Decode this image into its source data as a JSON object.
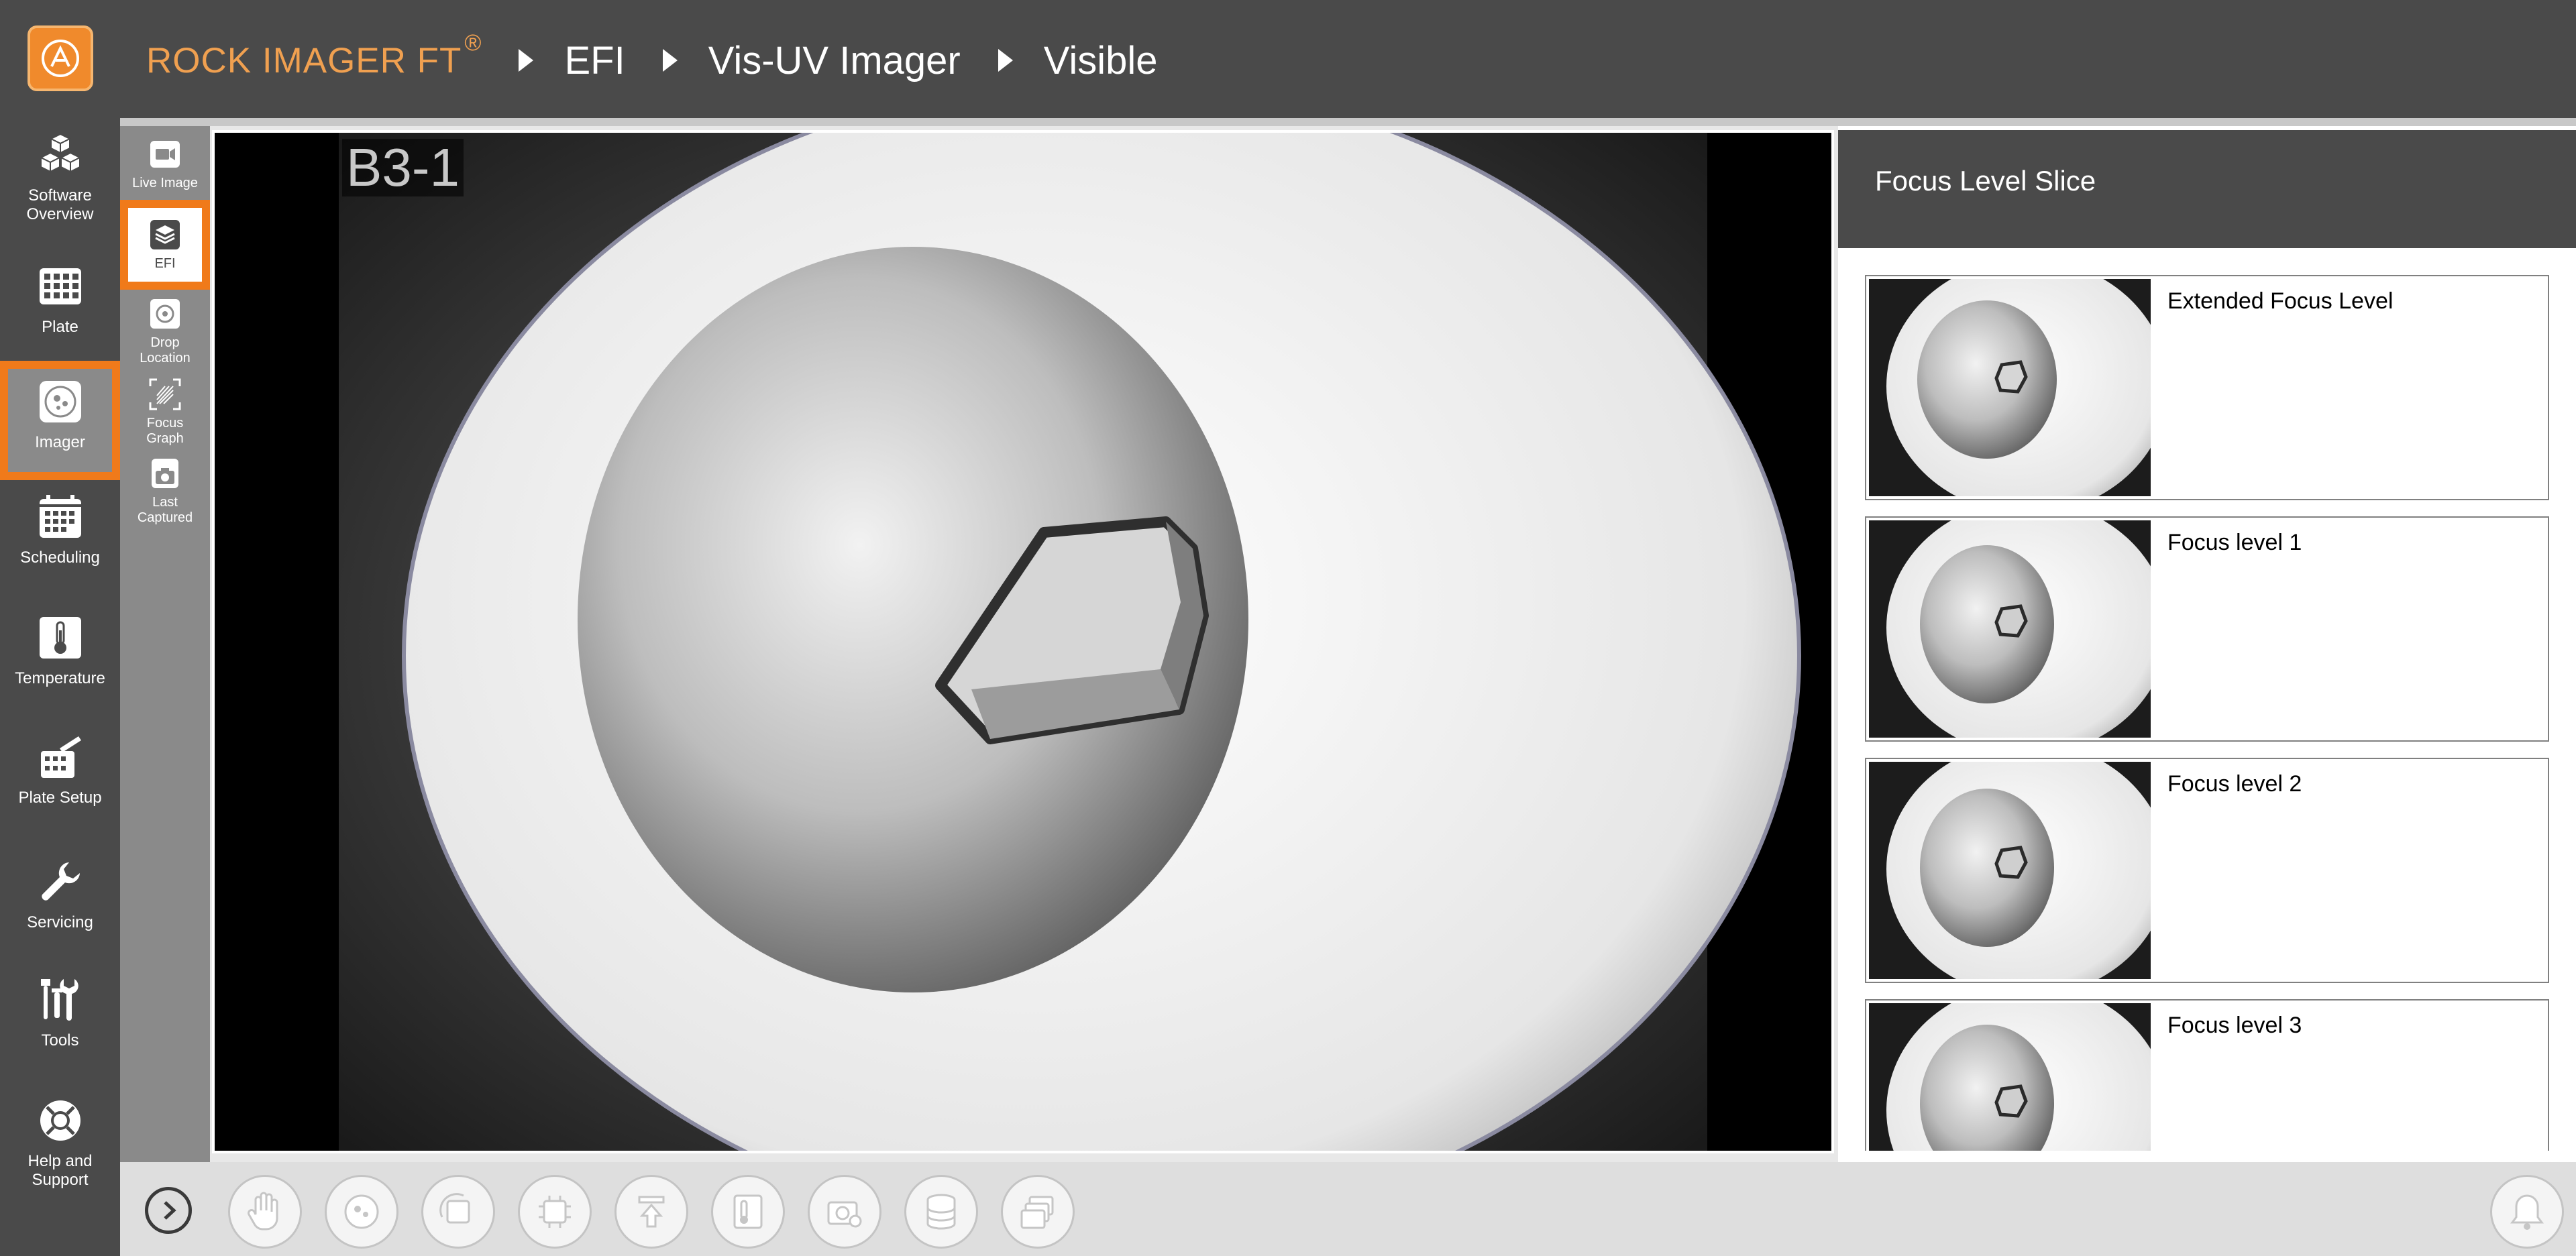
{
  "header": {
    "app_title": "ROCK IMAGER FT",
    "registered_mark": "®",
    "breadcrumb": [
      "EFI",
      "Vis-UV Imager",
      "Visible"
    ]
  },
  "nav": {
    "items": [
      {
        "label": "Software Overview",
        "icon": "cubes-icon"
      },
      {
        "label": "Plate",
        "icon": "plate-grid-icon"
      },
      {
        "label": "Imager",
        "icon": "imager-icon",
        "active": true
      },
      {
        "label": "Scheduling",
        "icon": "calendar-icon"
      },
      {
        "label": "Temperature",
        "icon": "thermometer-icon"
      },
      {
        "label": "Plate Setup",
        "icon": "plate-setup-icon"
      },
      {
        "label": "Servicing",
        "icon": "wrench-icon"
      },
      {
        "label": "Tools",
        "icon": "tools-icon"
      },
      {
        "label": "Help and Support",
        "icon": "lifebuoy-icon"
      }
    ]
  },
  "subnav": {
    "items": [
      {
        "label": "Live Image",
        "icon": "video-camera-icon"
      },
      {
        "label": "EFI",
        "icon": "layers-icon",
        "active": true
      },
      {
        "label": "Drop Location",
        "icon": "drop-location-icon"
      },
      {
        "label": "Focus Graph",
        "icon": "focus-graph-icon"
      },
      {
        "label": "Last Captured",
        "icon": "camera-icon"
      }
    ]
  },
  "viewer": {
    "well_label": "B3-1"
  },
  "focus_panel": {
    "title": "Focus Level Slice",
    "slices": [
      {
        "label": "Extended Focus Level"
      },
      {
        "label": "Focus level 1"
      },
      {
        "label": "Focus level 2"
      },
      {
        "label": "Focus level 3"
      }
    ]
  },
  "toolbar": {
    "tools": [
      "hand-icon",
      "plate-drop-icon",
      "rotate-plate-icon",
      "chip-icon",
      "eject-icon",
      "temperature-log-icon",
      "camera-settings-icon",
      "database-icon",
      "plate-stack-icon"
    ],
    "expand_icon": "chevron-right-icon",
    "notification_icon": "bell-icon"
  },
  "colors": {
    "accent": "#f07a1a",
    "header_bg": "#4a4a4a",
    "subnav_bg": "#8a8a8a"
  }
}
